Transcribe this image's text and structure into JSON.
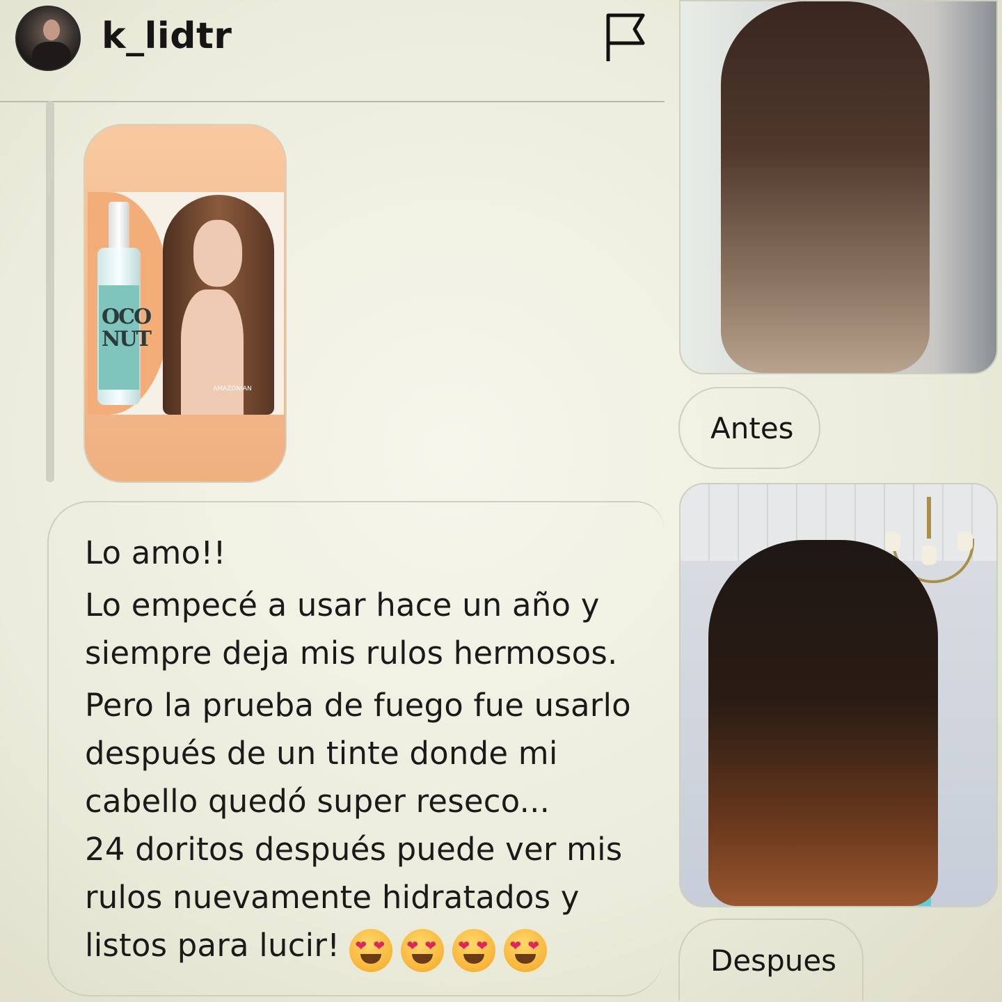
{
  "header": {
    "username": "k_lidtr",
    "avatar_icon": "profile-avatar",
    "flag_icon": "flag-icon"
  },
  "product_image": {
    "brand_mark": "AMAZONIAN"
  },
  "message": {
    "line1": "Lo amo!!",
    "line2": "Lo empecé a usar hace un año y siempre deja mis rulos hermosos.",
    "line3": "Pero la prueba de fuego fue usarlo después de un tinte donde mi cabello quedó super reseco...",
    "line4": "24 doritos después puede ver mis rulos nuevamente hidratados y listos para lucir!",
    "emoji_count": 4
  },
  "photos": {
    "before_label": "Antes",
    "after_label": "Despues"
  },
  "colors": {
    "background": "#ececdc",
    "text": "#151515",
    "bubble_border": "#cfcfc0",
    "product_orange": "#f3ad78",
    "label_teal": "#7fc4bd"
  }
}
